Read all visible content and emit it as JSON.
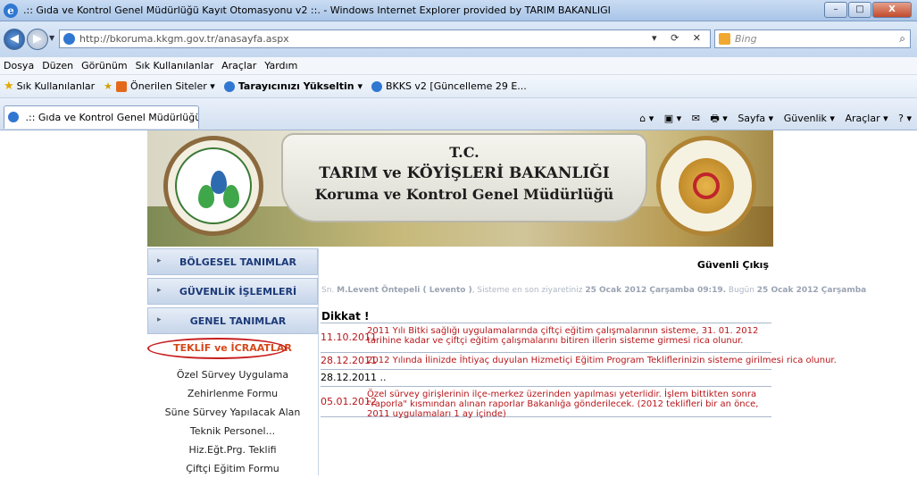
{
  "window": {
    "title": ".:: Gıda ve Kontrol Genel Müdürlüğü Kayıt Otomasyonu v2 ::. - Windows Internet Explorer provided by TARIM BAKANLIGI",
    "minimize": "–",
    "maximize": "□",
    "close": "X"
  },
  "address": {
    "url": "http://bkoruma.kkgm.gov.tr/anasayfa.aspx",
    "search_placeholder": "Bing",
    "tools": "▾ ⟳ ✕"
  },
  "menu": [
    "Dosya",
    "Düzen",
    "Görünüm",
    "Sık Kullanılanlar",
    "Araçlar",
    "Yardım"
  ],
  "favorites": {
    "label": "Sık Kullanılanlar",
    "items": [
      "Önerilen Siteler ▾",
      "Tarayıcınızı Yükseltin ▾",
      "BKKS v2 [Güncelleme 29 E..."
    ]
  },
  "tab": {
    "title": ".:: Gıda ve Kontrol Genel Müdürlüğü Kayıt Otoma..."
  },
  "commands": [
    "⌂ ▾",
    "▣ ▾",
    "✉",
    "🖶 ▾",
    "Sayfa ▾",
    "Güvenlik ▾",
    "Araçlar ▾",
    "? ▾"
  ],
  "banner": {
    "line1": "T.C.",
    "line2": "TARIM ve KÖYİŞLERİ BAKANLIĞI",
    "line3": "Koruma ve Kontrol Genel Müdürlüğü"
  },
  "sidebar": {
    "items": [
      "BÖLGESEL TANIMLAR",
      "GÜVENLİK İŞLEMLERİ",
      "GENEL TANIMLAR"
    ],
    "active": "TEKLİF ve İCRAATLAR",
    "submenu": [
      "Özel Sürvey Uygulama",
      "Zehirlenme Formu",
      "Süne Sürvey Yapılacak Alan",
      "Teknik Personel...",
      "Hiz.Eğt.Prg. Teklifi",
      "Çiftçi Eğitim Formu"
    ]
  },
  "content": {
    "logout": "Güvenli Çıkış",
    "user_prefix": "Sn.",
    "user_name": "M.Levent Öntepeli ( Levento )",
    "last_visit_text": ", Sisteme en son ziyaretiniz",
    "last_visit": "25 Ocak 2012 Çarşamba 09:19.",
    "today_text": "Bugün",
    "today": "25 Ocak 2012 Çarşamba",
    "notice_title": "Dikkat !",
    "announcements": [
      {
        "date": "11.10.2011",
        "text": "2011 Yılı Bitki sağlığı uygulamalarında çiftçi eğitim çalışmalarının sisteme, 31. 01. 2012 tarihine kadar ve çiftçi eğitim çalışmalarını bitiren illerin sisteme girmesi rica olunur."
      },
      {
        "date": "28.12.2011",
        "text": "2012 Yılında İlinizde İhtiyaç duyulan Hizmetiçi Eğitim Program Tekliflerinizin sisteme girilmesi rica olunur."
      },
      {
        "date": "28.12.2011 ..",
        "text": ""
      },
      {
        "date": "05.01.2012",
        "text": "Özel sürvey girişlerinin ilçe-merkez üzerinden yapılması yeterlidir. İşlem bittikten sonra \"raporla\" kısmından alınan raporlar Bakanlığa gönderilecek. (2012 teklifleri bir an önce, 2011 uygulamaları 1 ay içinde)"
      }
    ]
  }
}
